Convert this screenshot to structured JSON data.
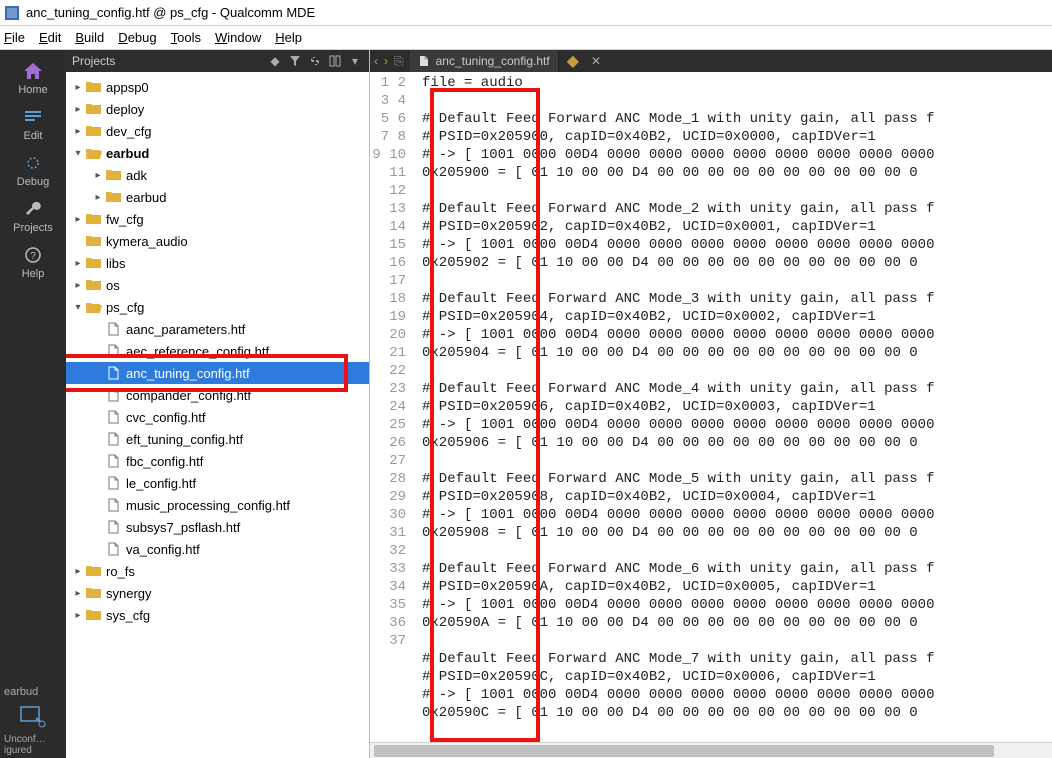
{
  "window": {
    "title": "anc_tuning_config.htf @ ps_cfg - Qualcomm MDE"
  },
  "menus": {
    "file": "File",
    "edit": "Edit",
    "build": "Build",
    "debug": "Debug",
    "tools": "Tools",
    "window": "Window",
    "help": "Help"
  },
  "leftbar": {
    "home": "Home",
    "edit": "Edit",
    "debug": "Debug",
    "projects": "Projects",
    "help": "Help",
    "bottom_label": "earbud",
    "bottom_status": "Unconf…\nigured"
  },
  "panel": {
    "title": "Projects"
  },
  "tree": {
    "items": [
      {
        "depth": 0,
        "arrow": "right",
        "type": "folder",
        "label": "appsp0"
      },
      {
        "depth": 0,
        "arrow": "right",
        "type": "folder",
        "label": "deploy"
      },
      {
        "depth": 0,
        "arrow": "right",
        "type": "folder",
        "label": "dev_cfg"
      },
      {
        "depth": 0,
        "arrow": "down",
        "type": "folder-open",
        "label": "earbud",
        "bold": true
      },
      {
        "depth": 1,
        "arrow": "right",
        "type": "folder",
        "label": "adk"
      },
      {
        "depth": 1,
        "arrow": "right",
        "type": "folder",
        "label": "earbud"
      },
      {
        "depth": 0,
        "arrow": "right",
        "type": "folder",
        "label": "fw_cfg"
      },
      {
        "depth": 0,
        "arrow": "none",
        "type": "folder",
        "label": "kymera_audio"
      },
      {
        "depth": 0,
        "arrow": "right",
        "type": "folder",
        "label": "libs"
      },
      {
        "depth": 0,
        "arrow": "right",
        "type": "folder",
        "label": "os"
      },
      {
        "depth": 0,
        "arrow": "down",
        "type": "folder-open",
        "label": "ps_cfg"
      },
      {
        "depth": 1,
        "arrow": "none",
        "type": "file",
        "label": "aanc_parameters.htf"
      },
      {
        "depth": 1,
        "arrow": "none",
        "type": "file",
        "label": "aec_reference_config.htf"
      },
      {
        "depth": 1,
        "arrow": "none",
        "type": "file",
        "label": "anc_tuning_config.htf",
        "selected": true
      },
      {
        "depth": 1,
        "arrow": "none",
        "type": "file",
        "label": "compander_config.htf"
      },
      {
        "depth": 1,
        "arrow": "none",
        "type": "file",
        "label": "cvc_config.htf"
      },
      {
        "depth": 1,
        "arrow": "none",
        "type": "file",
        "label": "eft_tuning_config.htf"
      },
      {
        "depth": 1,
        "arrow": "none",
        "type": "file",
        "label": "fbc_config.htf"
      },
      {
        "depth": 1,
        "arrow": "none",
        "type": "file",
        "label": "le_config.htf"
      },
      {
        "depth": 1,
        "arrow": "none",
        "type": "file",
        "label": "music_processing_config.htf"
      },
      {
        "depth": 1,
        "arrow": "none",
        "type": "file",
        "label": "subsys7_psflash.htf"
      },
      {
        "depth": 1,
        "arrow": "none",
        "type": "file",
        "label": "va_config.htf"
      },
      {
        "depth": 0,
        "arrow": "right",
        "type": "folder",
        "label": "ro_fs"
      },
      {
        "depth": 0,
        "arrow": "right",
        "type": "folder",
        "label": "synergy"
      },
      {
        "depth": 0,
        "arrow": "right",
        "type": "folder",
        "label": "sys_cfg"
      }
    ]
  },
  "tab": {
    "filename": "anc_tuning_config.htf"
  },
  "code_lines": [
    "file = audio",
    "",
    "# Default Feed Forward ANC Mode_1 with unity gain, all pass f",
    "# PSID=0x205900, capID=0x40B2, UCID=0x0000, capIDVer=1",
    "# -> [ 1001 0000 00D4 0000 0000 0000 0000 0000 0000 0000 0000",
    "0x205900 = [ 01 10 00 00 D4 00 00 00 00 00 00 00 00 00 00 0",
    "",
    "# Default Feed Forward ANC Mode_2 with unity gain, all pass f",
    "# PSID=0x205902, capID=0x40B2, UCID=0x0001, capIDVer=1",
    "# -> [ 1001 0000 00D4 0000 0000 0000 0000 0000 0000 0000 0000",
    "0x205902 = [ 01 10 00 00 D4 00 00 00 00 00 00 00 00 00 00 0",
    "",
    "# Default Feed Forward ANC Mode_3 with unity gain, all pass f",
    "# PSID=0x205904, capID=0x40B2, UCID=0x0002, capIDVer=1",
    "# -> [ 1001 0000 00D4 0000 0000 0000 0000 0000 0000 0000 0000",
    "0x205904 = [ 01 10 00 00 D4 00 00 00 00 00 00 00 00 00 00 0",
    "",
    "# Default Feed Forward ANC Mode_4 with unity gain, all pass f",
    "# PSID=0x205906, capID=0x40B2, UCID=0x0003, capIDVer=1",
    "# -> [ 1001 0000 00D4 0000 0000 0000 0000 0000 0000 0000 0000",
    "0x205906 = [ 01 10 00 00 D4 00 00 00 00 00 00 00 00 00 00 0",
    "",
    "# Default Feed Forward ANC Mode_5 with unity gain, all pass f",
    "# PSID=0x205908, capID=0x40B2, UCID=0x0004, capIDVer=1",
    "# -> [ 1001 0000 00D4 0000 0000 0000 0000 0000 0000 0000 0000",
    "0x205908 = [ 01 10 00 00 D4 00 00 00 00 00 00 00 00 00 00 0",
    "",
    "# Default Feed Forward ANC Mode_6 with unity gain, all pass f",
    "# PSID=0x20590A, capID=0x40B2, UCID=0x0005, capIDVer=1",
    "# -> [ 1001 0000 00D4 0000 0000 0000 0000 0000 0000 0000 0000",
    "0x20590A = [ 01 10 00 00 D4 00 00 00 00 00 00 00 00 00 00 0",
    "",
    "# Default Feed Forward ANC Mode_7 with unity gain, all pass f",
    "# PSID=0x20590C, capID=0x40B2, UCID=0x0006, capIDVer=1",
    "# -> [ 1001 0000 00D4 0000 0000 0000 0000 0000 0000 0000 0000",
    "0x20590C = [ 01 10 00 00 D4 00 00 00 00 00 00 00 00 00 00 0",
    ""
  ]
}
